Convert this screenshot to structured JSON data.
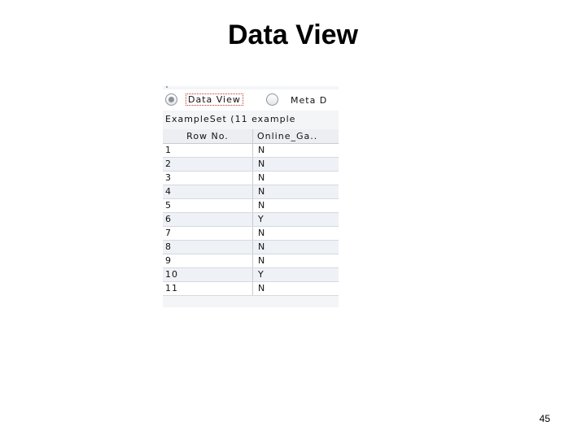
{
  "slide": {
    "title": "Data View",
    "page_number": "45"
  },
  "view_toggle": {
    "options": [
      {
        "label": "Data View",
        "selected": true
      },
      {
        "label": "Meta D",
        "selected": false
      }
    ]
  },
  "table": {
    "caption": "ExampleSet (11 example",
    "columns": [
      "Row No.",
      "Online_Ga.."
    ],
    "rows": [
      [
        "1",
        "N"
      ],
      [
        "2",
        "N"
      ],
      [
        "3",
        "N"
      ],
      [
        "4",
        "N"
      ],
      [
        "5",
        "N"
      ],
      [
        "6",
        "Y"
      ],
      [
        "7",
        "N"
      ],
      [
        "8",
        "N"
      ],
      [
        "9",
        "N"
      ],
      [
        "10",
        "Y"
      ],
      [
        "11",
        "N"
      ]
    ]
  },
  "colors": {
    "row_alt": "#eef1f5",
    "focus_border": "#c0392b"
  }
}
